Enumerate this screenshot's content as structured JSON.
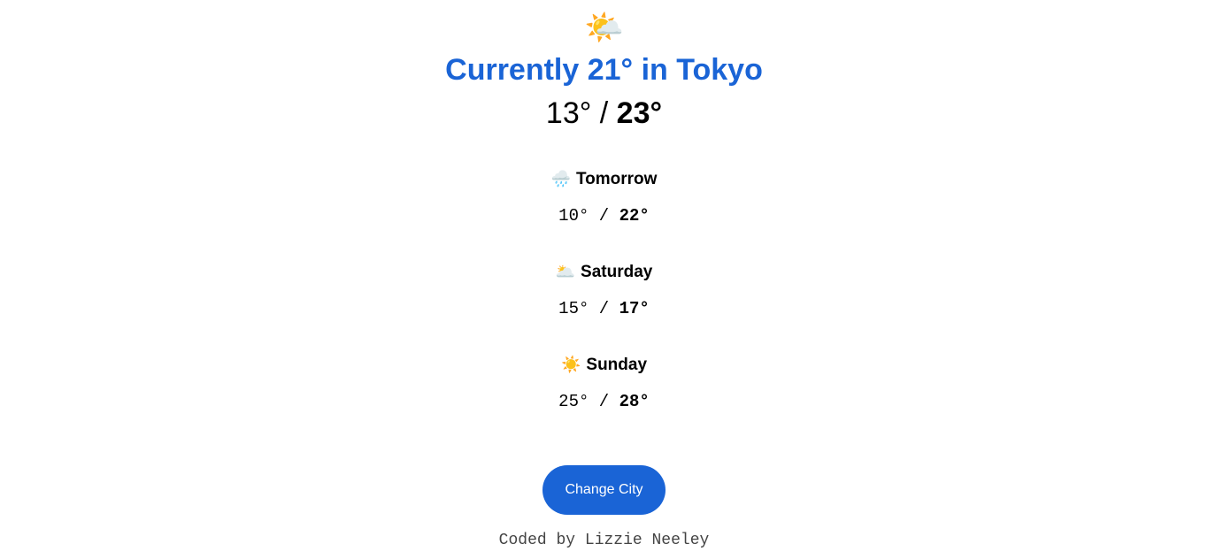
{
  "current": {
    "icon": "🌤️",
    "icon_name": "sun-behind-cloud-icon",
    "heading": "Currently 21° in Tokyo",
    "low": "13°",
    "separator": " / ",
    "high": "23°"
  },
  "forecast": [
    {
      "icon": "🌧️",
      "icon_name": "rain-cloud-icon",
      "day": "Tomorrow",
      "low": "10°",
      "separator": " / ",
      "high": "22°"
    },
    {
      "icon": "🌥️",
      "icon_name": "cloudy-icon",
      "day": "Saturday",
      "low": "15°",
      "separator": " / ",
      "high": "17°"
    },
    {
      "icon": "☀️",
      "icon_name": "sun-icon",
      "day": "Sunday",
      "low": "25°",
      "separator": " / ",
      "high": "28°"
    }
  ],
  "button": {
    "label": "Change City"
  },
  "footer": {
    "text": "Coded by Lizzie Neeley"
  },
  "colors": {
    "accent": "#1a64d6",
    "footer_text": "#444444"
  }
}
